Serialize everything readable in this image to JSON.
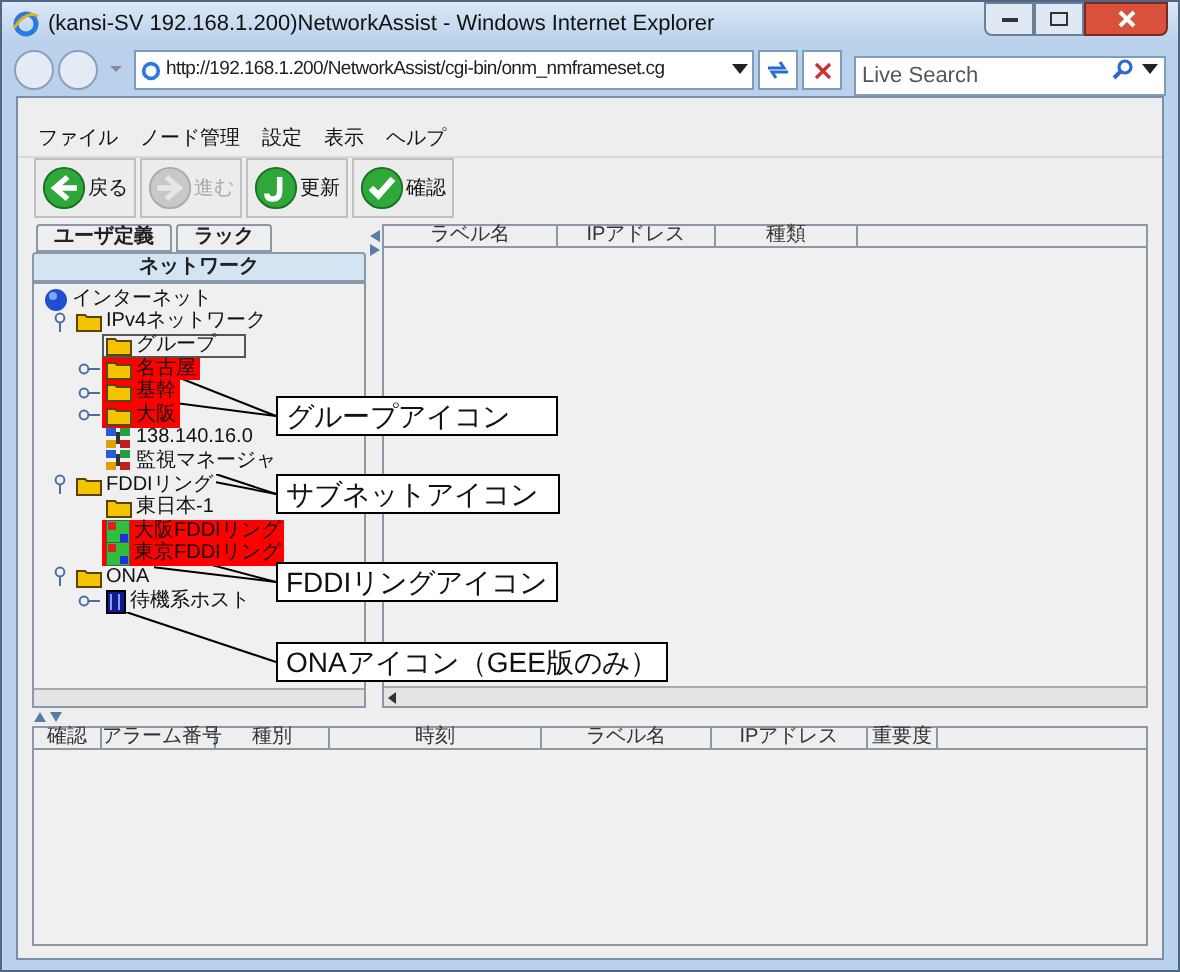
{
  "window": {
    "title": "(kansi-SV 192.168.1.200)NetworkAssist - Windows Internet Explorer"
  },
  "address_bar": {
    "value": "http://192.168.1.200/NetworkAssist/cgi-bin/onm_nmframeset.cg"
  },
  "search": {
    "placeholder": "Live Search"
  },
  "menu": [
    "ファイル",
    "ノード管理",
    "設定",
    "表示",
    "ヘルプ"
  ],
  "toolbar": [
    {
      "kind": "back",
      "label": "戻る",
      "disabled": false
    },
    {
      "kind": "forward",
      "label": "進む",
      "disabled": true
    },
    {
      "kind": "refresh",
      "label": "更新",
      "disabled": false
    },
    {
      "kind": "confirm",
      "label": "確認",
      "disabled": false
    }
  ],
  "tab_rows": [
    [
      {
        "label": "ユーザ定義",
        "selected": false
      },
      {
        "label": "ラック",
        "selected": false
      }
    ],
    [
      {
        "label": "ネットワーク",
        "selected": true
      }
    ]
  ],
  "tree": [
    {
      "label": "インターネット",
      "kind": "globe",
      "highlighted": false,
      "selected": false,
      "children": [
        {
          "label": "IPv4ネットワーク",
          "kind": "folder",
          "expanded": true,
          "highlighted": false,
          "selected": false,
          "children": [
            {
              "label": "グループ",
              "kind": "folder",
              "highlighted": false,
              "selected": true
            },
            {
              "label": "名古屋",
              "kind": "folder",
              "expanded": false,
              "highlighted": true,
              "selected": false
            },
            {
              "label": "基幹",
              "kind": "folder",
              "expanded": false,
              "highlighted": true,
              "selected": false
            },
            {
              "label": "大阪",
              "kind": "folder",
              "expanded": false,
              "highlighted": true,
              "selected": false
            },
            {
              "label": "138.140.16.0",
              "kind": "subnet",
              "highlighted": false,
              "selected": false
            },
            {
              "label": "監視マネージャ",
              "kind": "subnet",
              "highlighted": false,
              "selected": false
            }
          ]
        },
        {
          "label": "FDDIリング",
          "kind": "folder",
          "expanded": true,
          "highlighted": false,
          "selected": false,
          "children": [
            {
              "label": "東日本-1",
              "kind": "folder",
              "highlighted": false,
              "selected": false
            },
            {
              "label": "大阪FDDIリング",
              "kind": "fddi",
              "highlighted": true,
              "selected": false
            },
            {
              "label": "東京FDDIリング",
              "kind": "fddi",
              "highlighted": true,
              "selected": false
            }
          ]
        },
        {
          "label": "ONA",
          "kind": "folder",
          "expanded": true,
          "highlighted": false,
          "selected": false,
          "children": [
            {
              "label": "待機系ホスト",
              "kind": "host",
              "expanded": false,
              "highlighted": false,
              "selected": false
            }
          ]
        }
      ]
    }
  ],
  "node_table": {
    "columns": [
      "ラベル名",
      "IPアドレス",
      "種類"
    ]
  },
  "alarm_table": {
    "columns": [
      "確認",
      "アラーム番号",
      "種別",
      "時刻",
      "ラベル名",
      "IPアドレス",
      "重要度"
    ]
  },
  "callouts": [
    "グループアイコン",
    "サブネットアイコン",
    "FDDIリングアイコン",
    "ONAアイコン（GEE版のみ）"
  ]
}
